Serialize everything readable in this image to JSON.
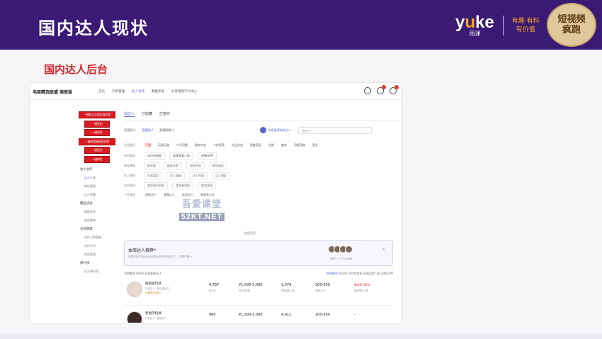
{
  "header": {
    "title": "国内达人现状",
    "brand_logo_a": "y",
    "brand_logo_u": "u",
    "brand_logo_b": "ke",
    "brand_logo_sub": "雨课",
    "slogan_line1": "有趣·有料",
    "slogan_line2": "有价值",
    "badge_line1": "短视频",
    "badge_line2": "疯跑"
  },
  "subtitle": "国内达人后台",
  "app": {
    "name": "电商精选联盟 商家版",
    "nav": [
      "首页",
      "订单管理",
      "达人合作",
      "数据参谋",
      "抖音电商学习中心"
    ]
  },
  "sidebar": {
    "red_buttons": [
      "一键抢占本地化商达榜",
      "一键签约",
      "一键带货",
      "一键查看精选商达榜",
      "一键签约",
      "一键带货"
    ],
    "sections": [
      {
        "title": "达人合作",
        "items": [
          "达人广场",
          "商达管理",
          "达人招募"
        ]
      },
      {
        "title": "爆品活动",
        "items": [
          "爆款秒杀",
          "商品榜单"
        ]
      },
      {
        "title": "合作管理",
        "items": [
          "合作订单管理",
          "合作计划",
          "商品管理"
        ]
      },
      {
        "title": "排行榜",
        "items": [
          "达人排行榜"
        ]
      }
    ]
  },
  "main": {
    "tabs": [
      "找达人",
      "已收藏",
      "已签约"
    ],
    "filter_top": [
      "全部达人",
      "直播达人",
      "短视频达人"
    ],
    "ai_pill": "为您推荐带货达人",
    "search_placeholder": "搜索达人",
    "rows": [
      {
        "label": "主营类目",
        "chips": [
          "不限",
          "玩具乐器",
          "二手闲置",
          "服饰内衣",
          "个护家清",
          "礼品文创",
          "智能家居",
          "生鲜",
          "美妆",
          "母婴宠物"
        ],
        "extra": "更多"
      },
      {
        "label": "带货数据",
        "chips": [
          "场均销售额",
          "直播观看人数",
          "直播GPM"
        ]
      },
      {
        "label": "粉丝数据",
        "chips": [
          "粉丝量",
          "粉丝年龄",
          "粉丝性别",
          "粉丝地区"
        ]
      },
      {
        "label": "达人属性",
        "chips": [
          "内容类型",
          "达人等级",
          "达人性别",
          "达人地区"
        ]
      },
      {
        "label": "其他筛选",
        "chips": [
          "是否签约机构",
          "是否有资质",
          "是否优选"
        ]
      },
      {
        "label": "个性筛选",
        "chips": [
          "团购达人",
          "星图达人",
          "优质达人",
          "有联系方式"
        ]
      }
    ],
    "more_filters": "收起更多",
    "watermark_1": "吾爱课堂",
    "watermark_2": "52KT.NET",
    "recommend": {
      "title": "本周达人推荐",
      "mark": "*",
      "desc": "根据您的店铺与商品信息为您精选优质达人，查看详情 >",
      "count": "每周一上午10点更新",
      "close": "×"
    },
    "sort_label": "为你推荐1000+位匹配的达人",
    "sort_options": [
      "综合推荐",
      "粉丝数",
      "场均销售额",
      "直播观看人数",
      "直播GPM"
    ],
    "cards": [
      {
        "name": "招招爱玩具",
        "sub": "抖音达人 · 粉丝量适中",
        "tag": "近期带货商品 >",
        "fans": "4,767",
        "fans_label": "粉丝量",
        "sales": "¥1,000-5,000",
        "sales_label": "场均销售额",
        "viewers": "1,079",
        "viewers_label": "直播观看人数",
        "gpm": "100-500",
        "gpm_label": "直播GPM",
        "extra": "佣金率 30%",
        "extra_label": "推荐指数 优质"
      },
      {
        "name": "老爸的玩具",
        "sub": "抖音达人 · 直播达人",
        "tag": "",
        "fans": "960",
        "fans_label": "粉丝量",
        "sales": "¥1,000-5,000",
        "sales_label": "场均销售额",
        "viewers": "4,911",
        "viewers_label": "直播观看人数",
        "gpm": "100-500",
        "gpm_label": "直播GPM",
        "extra": "-",
        "extra_label": ""
      }
    ]
  },
  "colors": {
    "header_bg": "#3a1a74",
    "accent_red": "#d81b22",
    "accent_blue": "#5b62d6"
  }
}
